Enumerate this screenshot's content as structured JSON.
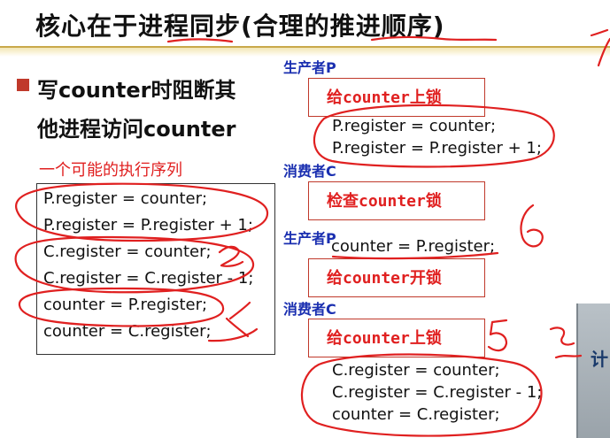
{
  "slide": {
    "title": "核心在于进程同步(合理的推进顺序)",
    "bullet": {
      "line1": "写counter时阻断其",
      "line2": "他进程访问counter"
    },
    "sequence_heading": "一个可能的执行序列",
    "sequence_lines": [
      "P.register = counter;",
      "P.register = P.register + 1;",
      "C.register = counter;",
      "C.register = C.register - 1;",
      "counter = P.register;",
      "counter = C.register;"
    ],
    "producer_label_1": "生产者P",
    "lock_step": "给counter上锁",
    "producer_code": [
      "P.register = counter;",
      "P.register = P.register + 1;"
    ],
    "consumer_label_1": "消费者C",
    "check_step": "检查counter锁",
    "producer_label_2": "生产者P",
    "producer_code_2": "counter = P.register;",
    "unlock_step": "给counter开锁",
    "consumer_label_2": "消费者C",
    "lock_step_2": "给counter上锁",
    "consumer_code": [
      "C.register = counter;",
      "C.register = C.register - 1;",
      "counter = C.register;"
    ],
    "photo_text": "计"
  },
  "colors": {
    "ink_red": "#e02020",
    "heading_blue": "#1a2fb0",
    "bullet": "#c0392b",
    "title_rule": "#c9a84a"
  }
}
